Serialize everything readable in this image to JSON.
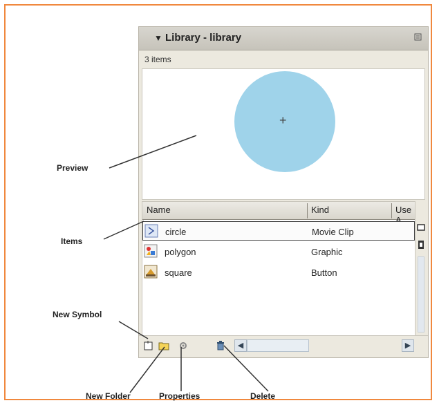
{
  "panel": {
    "title": "Library - library",
    "collapse_icon": "triangle-down-icon",
    "options_icon": "panel-options-icon",
    "item_count": "3 items"
  },
  "list": {
    "columns": [
      "Name",
      "Kind",
      "Use A"
    ],
    "rows": [
      {
        "name": "circle",
        "kind": "Movie Clip",
        "icon": "movie-clip-icon",
        "selected": true
      },
      {
        "name": "polygon",
        "kind": "Graphic",
        "icon": "graphic-icon",
        "selected": false
      },
      {
        "name": "square",
        "kind": "Button",
        "icon": "button-icon",
        "selected": false
      }
    ]
  },
  "callouts": {
    "preview": "Preview",
    "items": "Items",
    "new_symbol": "New Symbol",
    "new_folder": "New Folder",
    "properties": "Properties",
    "delete": "Delete"
  },
  "colors": {
    "frame_border": "#f0883e",
    "preview_circle": "#9fd3ea",
    "panel_bg": "#ece9df"
  }
}
